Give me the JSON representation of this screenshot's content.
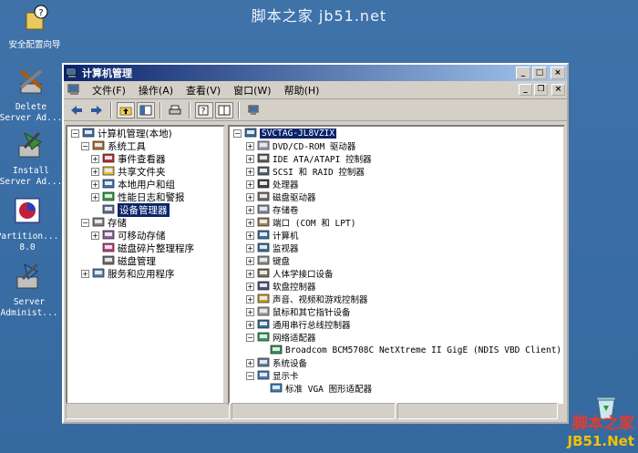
{
  "watermark_top": "脚本之家 jb51.net",
  "desktop_icons": [
    {
      "label1": "安全配置向导",
      "label2": ""
    },
    {
      "label1": "Delete",
      "label2": "Server Ad..."
    },
    {
      "label1": "Install",
      "label2": "Server Ad..."
    },
    {
      "label1": "Partition...",
      "label2": "8.0"
    },
    {
      "label1": "Server",
      "label2": "Administ..."
    }
  ],
  "window": {
    "title": "计算机管理",
    "controls": {
      "minimize": "_",
      "maximize": "□",
      "close": "×"
    },
    "inner_controls": {
      "minimize": "_",
      "restore": "❐",
      "close": "×"
    }
  },
  "menu": [
    "文件(F)",
    "操作(A)",
    "查看(V)",
    "窗口(W)",
    "帮助(H)"
  ],
  "left_tree": [
    {
      "level": 0,
      "exp": "-",
      "label": "计算机管理(本地)",
      "icon": "computer-icon"
    },
    {
      "level": 1,
      "exp": "-",
      "label": "系统工具",
      "icon": "tools-icon"
    },
    {
      "level": 2,
      "exp": "+",
      "label": "事件查看器",
      "icon": "event-icon"
    },
    {
      "level": 2,
      "exp": "+",
      "label": "共享文件夹",
      "icon": "folder-icon"
    },
    {
      "level": 2,
      "exp": "+",
      "label": "本地用户和组",
      "icon": "users-icon"
    },
    {
      "level": 2,
      "exp": "+",
      "label": "性能日志和警报",
      "icon": "perf-icon"
    },
    {
      "level": 2,
      "exp": "",
      "label": "设备管理器",
      "icon": "device-manager-icon",
      "selected": true
    },
    {
      "level": 1,
      "exp": "-",
      "label": "存储",
      "icon": "storage-icon"
    },
    {
      "level": 2,
      "exp": "+",
      "label": "可移动存储",
      "icon": "removable-icon"
    },
    {
      "level": 2,
      "exp": "",
      "label": "磁盘碎片整理程序",
      "icon": "defrag-icon"
    },
    {
      "level": 2,
      "exp": "",
      "label": "磁盘管理",
      "icon": "disk-icon"
    },
    {
      "level": 1,
      "exp": "+",
      "label": "服务和应用程序",
      "icon": "services-icon"
    }
  ],
  "right_tree": [
    {
      "level": 0,
      "exp": "-",
      "label": "SVCTAG-JL8VZIX",
      "icon": "computer-icon",
      "selected": true
    },
    {
      "level": 1,
      "exp": "+",
      "label": "DVD/CD-ROM 驱动器",
      "icon": "cdrom-icon"
    },
    {
      "level": 1,
      "exp": "+",
      "label": "IDE ATA/ATAPI 控制器",
      "icon": "ide-icon"
    },
    {
      "level": 1,
      "exp": "+",
      "label": "SCSI 和 RAID 控制器",
      "icon": "scsi-icon"
    },
    {
      "level": 1,
      "exp": "+",
      "label": "处理器",
      "icon": "cpu-icon"
    },
    {
      "level": 1,
      "exp": "+",
      "label": "磁盘驱动器",
      "icon": "disk-icon"
    },
    {
      "level": 1,
      "exp": "+",
      "label": "存储卷",
      "icon": "volume-icon"
    },
    {
      "level": 1,
      "exp": "+",
      "label": "端口 (COM 和 LPT)",
      "icon": "port-icon"
    },
    {
      "level": 1,
      "exp": "+",
      "label": "计算机",
      "icon": "computer-icon"
    },
    {
      "level": 1,
      "exp": "+",
      "label": "监视器",
      "icon": "monitor-icon"
    },
    {
      "level": 1,
      "exp": "+",
      "label": "键盘",
      "icon": "keyboard-icon"
    },
    {
      "level": 1,
      "exp": "+",
      "label": "人体学接口设备",
      "icon": "hid-icon"
    },
    {
      "level": 1,
      "exp": "+",
      "label": "软盘控制器",
      "icon": "floppy-icon"
    },
    {
      "level": 1,
      "exp": "+",
      "label": "声音、视频和游戏控制器",
      "icon": "sound-icon"
    },
    {
      "level": 1,
      "exp": "+",
      "label": "鼠标和其它指针设备",
      "icon": "mouse-icon"
    },
    {
      "level": 1,
      "exp": "+",
      "label": "通用串行总线控制器",
      "icon": "usb-icon"
    },
    {
      "level": 1,
      "exp": "-",
      "label": "网络适配器",
      "icon": "network-icon"
    },
    {
      "level": 2,
      "exp": "",
      "label": "Broadcom BCM5708C NetXtreme II GigE (NDIS VBD Client)",
      "icon": "nic-icon"
    },
    {
      "level": 1,
      "exp": "+",
      "label": "系统设备",
      "icon": "system-icon"
    },
    {
      "level": 1,
      "exp": "-",
      "label": "显示卡",
      "icon": "display-icon"
    },
    {
      "level": 2,
      "exp": "",
      "label": "标准 VGA 图形适配器",
      "icon": "vga-icon"
    }
  ],
  "watermark_bottom": {
    "line1": "脚本之家",
    "line2": "JB51.Net"
  }
}
